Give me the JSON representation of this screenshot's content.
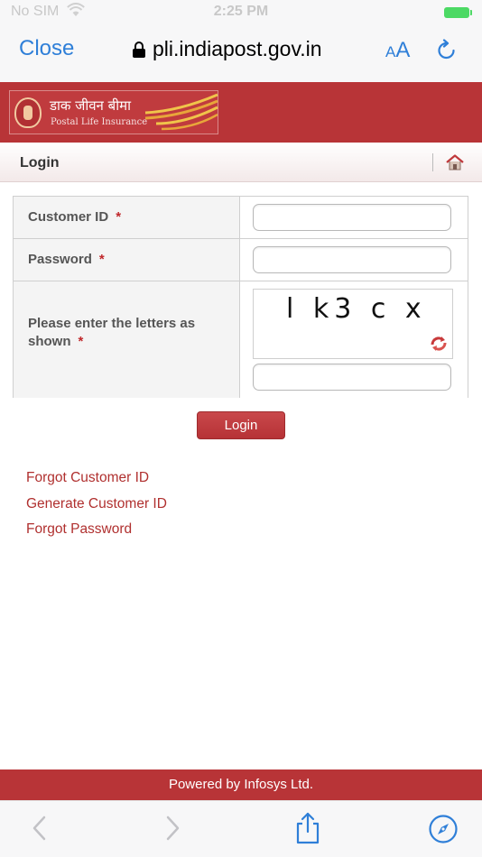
{
  "status_bar": {
    "carrier": "No SIM",
    "time": "2:25 PM"
  },
  "browser": {
    "close_label": "Close",
    "url": "pli.indiapost.gov.in",
    "text_size_small": "A",
    "text_size_big": "A"
  },
  "banner": {
    "logo_hindi": "डाक जीवन बीमा",
    "logo_english": "Postal Life Insurance"
  },
  "subheader": {
    "title": "Login"
  },
  "form": {
    "customer_id_label": "Customer ID",
    "password_label": "Password",
    "captcha_label": "Please enter the letters as shown",
    "required_mark": "*",
    "customer_id_value": "",
    "password_value": "",
    "captcha_value": "",
    "captcha_text": "l k3 c x"
  },
  "login_button": "Login",
  "links": {
    "forgot_customer_id": "Forgot Customer ID",
    "generate_customer_id": "Generate Customer ID",
    "forgot_password": "Forgot Password"
  },
  "footer": {
    "text": "Powered by Infosys Ltd."
  },
  "colors": {
    "brand_red": "#b83437",
    "link_red": "#b0302f",
    "ios_blue": "#2f7fd8",
    "battery_green": "#4cd964"
  },
  "icons": [
    "lock-icon",
    "reload-icon",
    "home-icon",
    "captcha-refresh-icon",
    "back-icon",
    "forward-icon",
    "share-icon",
    "compass-icon",
    "wifi-icon",
    "battery-icon"
  ]
}
